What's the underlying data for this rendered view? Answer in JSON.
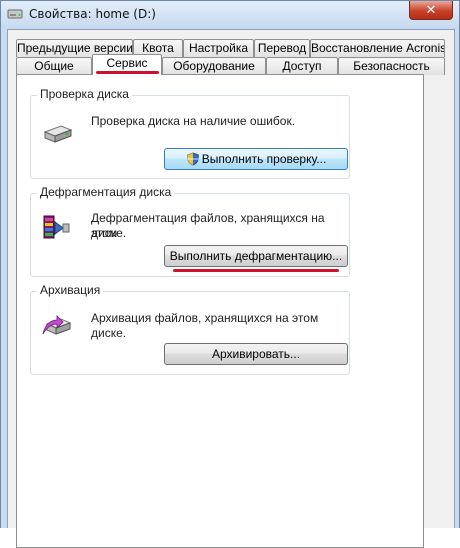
{
  "window": {
    "title": "Свойства: home (D:)",
    "close_glyph": "✕"
  },
  "tabs": {
    "row1": [
      {
        "label": "Предыдущие версии"
      },
      {
        "label": "Квота"
      },
      {
        "label": "Настройка"
      },
      {
        "label": "Перевод"
      },
      {
        "label": "Восстановление Acronis"
      }
    ],
    "row2": [
      {
        "label": "Общие"
      },
      {
        "label": "Сервис",
        "active": true
      },
      {
        "label": "Оборудование"
      },
      {
        "label": "Доступ"
      },
      {
        "label": "Безопасность"
      }
    ]
  },
  "groups": {
    "check": {
      "title": "Проверка диска",
      "description": "Проверка диска на наличие ошибок.",
      "button": "Выполнить проверку...",
      "icon": "disk-drive-icon"
    },
    "defrag": {
      "title": "Дефрагментация диска",
      "description_line1": "Дефрагментация файлов, хранящихся на этом",
      "description_line2": "диске.",
      "button": "Выполнить дефрагментацию...",
      "icon": "defrag-icon"
    },
    "backup": {
      "title": "Архивация",
      "description": "Архивация файлов, хранящихся на этом диске.",
      "button": "Архивировать...",
      "icon": "backup-icon"
    }
  },
  "colors": {
    "annotation": "#d0102a",
    "focus_border": "#3c7fb1"
  }
}
